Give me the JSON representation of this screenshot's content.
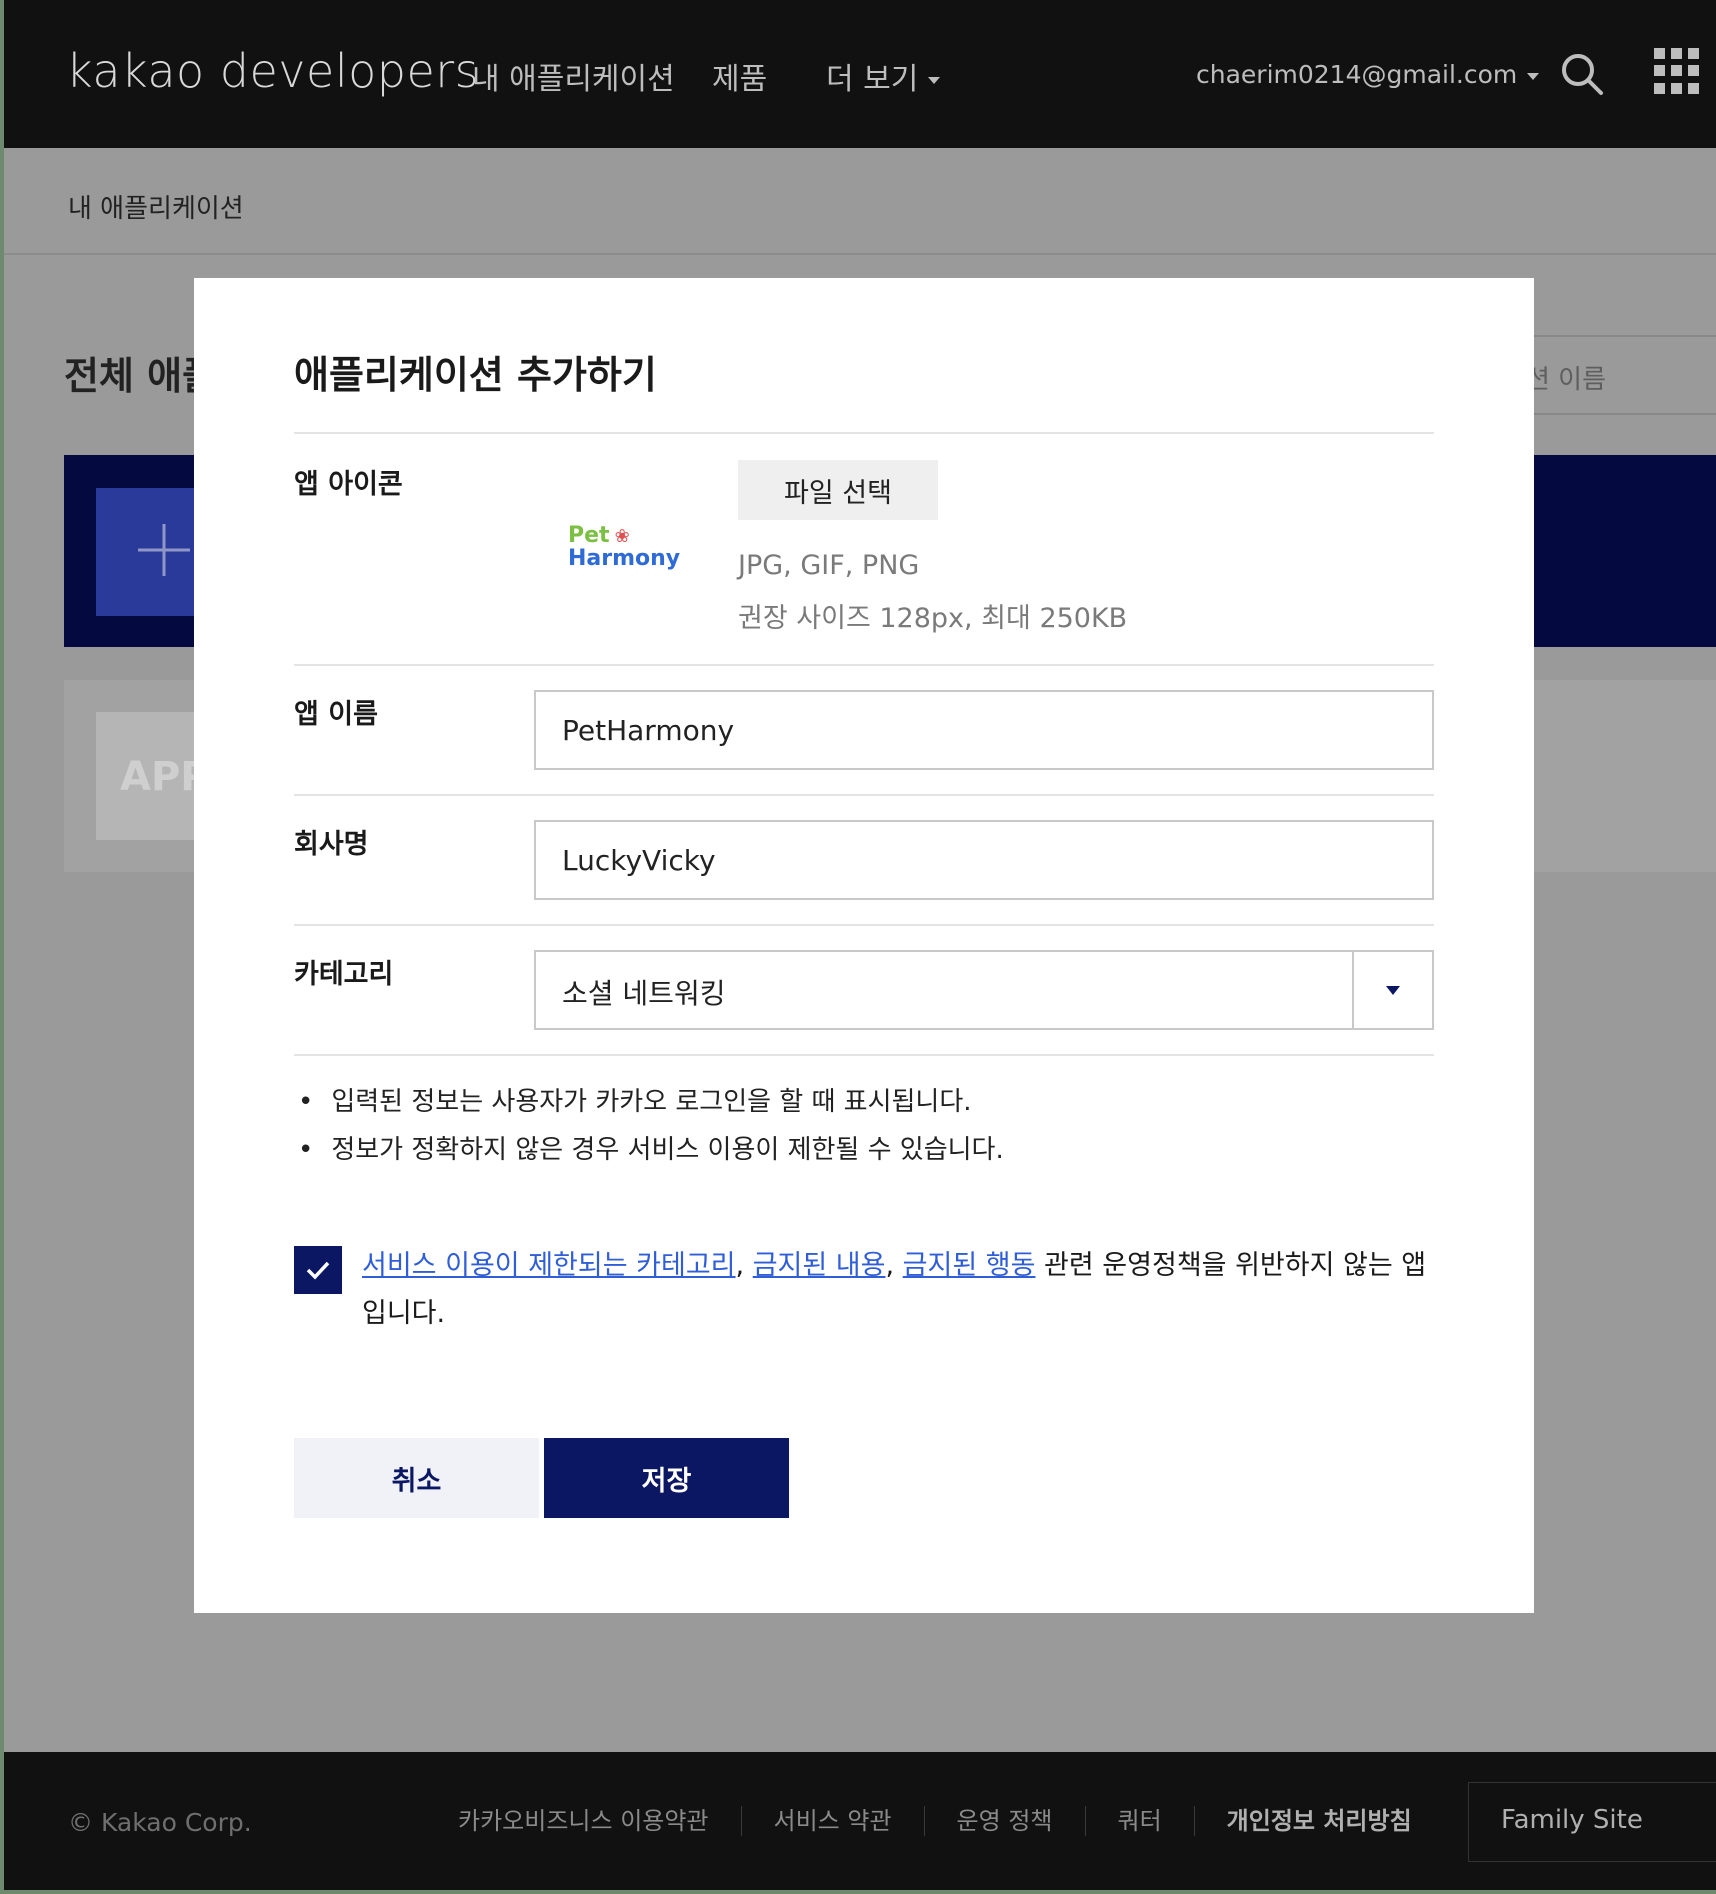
{
  "header": {
    "logo": "kakao developers",
    "nav": [
      "내 애플리케이션",
      "제품",
      "더 보기"
    ],
    "user_email": "chaerim0214@gmail.com"
  },
  "breadcrumb": "내 애플리케이션",
  "background": {
    "section_title": "전체 애플",
    "search_placeholder": "션 이름",
    "app_placeholder": "APP"
  },
  "modal": {
    "title": "애플리케이션 추가하기",
    "icon_label": "앱 아이콘",
    "file_button": "파일 선택",
    "logo_top": "Pet",
    "logo_bottom": "Harmony",
    "file_hint_1": "JPG, GIF, PNG",
    "file_hint_2": "권장 사이즈 128px, 최대 250KB",
    "app_name_label": "앱 이름",
    "app_name_value": "PetHarmony",
    "company_label": "회사명",
    "company_value": "LuckyVicky",
    "category_label": "카테고리",
    "category_value": "소셜 네트워킹",
    "notes": [
      "입력된 정보는 사용자가 카카오 로그인을 할 때 표시됩니다.",
      "정보가 정확하지 않은 경우 서비스 이용이 제한될 수 있습니다."
    ],
    "agree": {
      "link_1": "서비스 이용이 제한되는 카테고리",
      "sep_1": ", ",
      "link_2": "금지된 내용",
      "sep_2": ", ",
      "link_3": "금지된 행동",
      "tail": " 관련 운영정책을 위반하지 않는 앱입니다.",
      "checked": true
    },
    "cancel_label": "취소",
    "save_label": "저장"
  },
  "footer": {
    "copyright": "© Kakao Corp.",
    "links": [
      "카카오비즈니스 이용약관",
      "서비스 약관",
      "운영 정책",
      "쿼터",
      "개인정보 처리방침"
    ],
    "family_site": "Family Site"
  },
  "colors": {
    "primary": "#0b1763",
    "link": "#2f5ed8",
    "header_bg": "#111111"
  }
}
